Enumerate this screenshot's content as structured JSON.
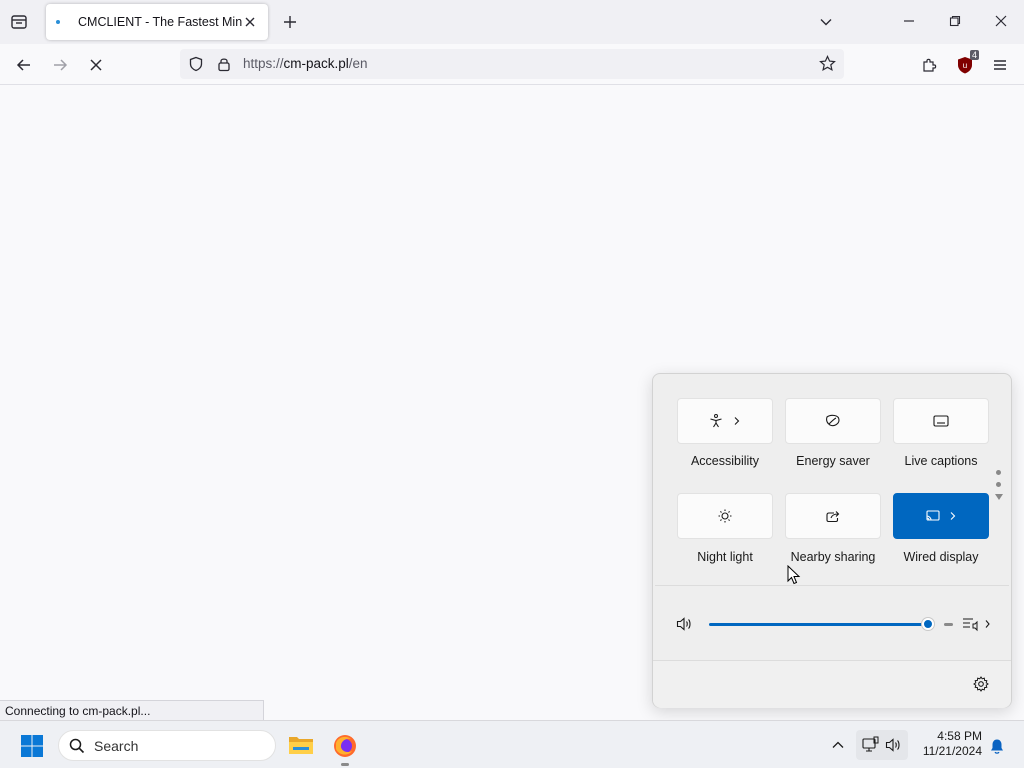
{
  "tab": {
    "title": "CMCLIENT - The Fastest Minecraft Client"
  },
  "urlbar": {
    "scheme": "https://",
    "host": "cm-pack.pl",
    "path": "/en"
  },
  "toolbar": {
    "extension_badge": "4"
  },
  "status": {
    "text": "Connecting to cm-pack.pl..."
  },
  "quick_settings": {
    "tiles": [
      {
        "label": "Accessibility",
        "icon": "accessibility-icon",
        "active": false,
        "has_chevron": true
      },
      {
        "label": "Energy saver",
        "icon": "energy-saver-icon",
        "active": false,
        "has_chevron": false
      },
      {
        "label": "Live captions",
        "icon": "live-captions-icon",
        "active": false,
        "has_chevron": false
      },
      {
        "label": "Night light",
        "icon": "night-light-icon",
        "active": false,
        "has_chevron": false
      },
      {
        "label": "Nearby sharing",
        "icon": "nearby-sharing-icon",
        "active": false,
        "has_chevron": false
      },
      {
        "label": "Wired display",
        "icon": "cast-icon",
        "active": true,
        "has_chevron": true
      }
    ],
    "volume_level": 0.97,
    "accent_color": "#0067c0"
  },
  "taskbar": {
    "search_label": "Search",
    "time": "4:58 PM",
    "date": "11/21/2024"
  }
}
